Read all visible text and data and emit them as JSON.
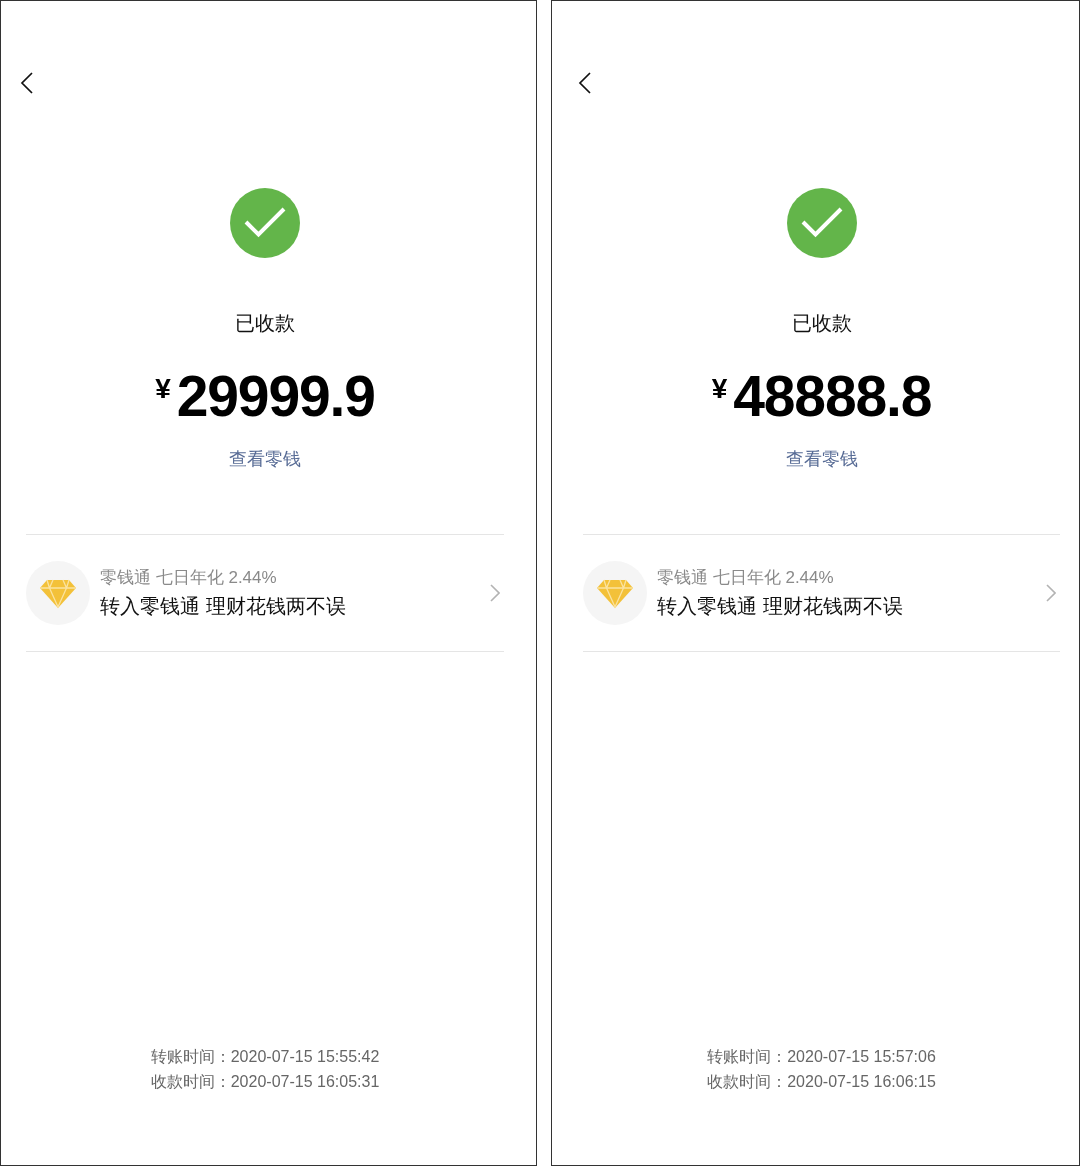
{
  "screens": [
    {
      "status": {
        "kind": "success",
        "label": "已收款"
      },
      "currency": "¥",
      "amount": "29999.9",
      "link": "查看零钱",
      "promo": {
        "subtitle": "零钱通 七日年化 2.44%",
        "title": "转入零钱通 理财花钱两不误"
      },
      "times": [
        "转账时间：2020-07-15 15:55:42",
        "收款时间：2020-07-15 16:05:31"
      ]
    },
    {
      "status": {
        "kind": "success",
        "label": "已收款"
      },
      "currency": "¥",
      "amount": "48888.8",
      "link": "查看零钱",
      "promo": {
        "subtitle": "零钱通 七日年化 2.44%",
        "title": "转入零钱通 理财花钱两不误"
      },
      "times": [
        "转账时间：2020-07-15 15:57:06",
        "收款时间：2020-07-15 16:06:15"
      ]
    }
  ]
}
